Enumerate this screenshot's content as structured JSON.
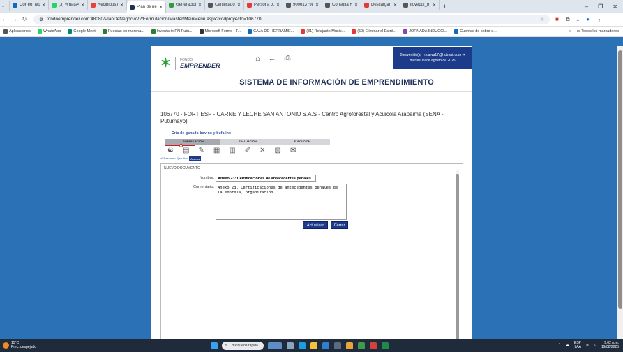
{
  "browser": {
    "tabs": [
      {
        "label": "Correo: Ivonn",
        "color": "#0f6cbd"
      },
      {
        "label": "(3) WhatsApp",
        "color": "#25d366"
      },
      {
        "label": "Recibidos (156",
        "color": "#ea4335"
      },
      {
        "label": "Plan de negoci",
        "color": "#1d2e57",
        "active": true
      },
      {
        "label": "Generación de",
        "color": "#2e9e3a"
      },
      {
        "label": "Certificado de",
        "color": "#555555"
      },
      {
        "label": "Persona Jurídic",
        "color": "#e53935"
      },
      {
        "label": "9006137984 (",
        "color": "#555555"
      },
      {
        "label": "Consulta RNM",
        "color": "#555555"
      },
      {
        "label": "Descargar arch",
        "color": "#e53935"
      },
      {
        "label": "ilovepdf_merg",
        "color": "#555555"
      }
    ],
    "url": "fondoemprender.com:48080/PlanDeNegocioV2/Formulacion/Master/MainMenu.aspx?codproyecto=106770",
    "bookmarks": [
      {
        "label": "Aplicaciones",
        "color": "#555555"
      },
      {
        "label": "WhatsApp",
        "color": "#25d366"
      },
      {
        "label": "Google Meet",
        "color": "#00897b"
      },
      {
        "label": "Puestas en marcha...",
        "color": "#2e7d32"
      },
      {
        "label": "Inventario PN Putu...",
        "color": "#2e7d32"
      },
      {
        "label": "Microsoft Forms - F...",
        "color": "#333333"
      },
      {
        "label": "CAJA DE HERRAMIE...",
        "color": "#0f6cbd"
      },
      {
        "label": "(31) Relajante Músic...",
        "color": "#e53935"
      },
      {
        "label": "(50) Eliminar el Estré...",
        "color": "#e53935"
      },
      {
        "label": "JORNADA INDUCCI...",
        "color": "#8e44ad"
      },
      {
        "label": "Cuentas de cobro e...",
        "color": "#0f6cbd"
      }
    ],
    "all_bookmarks": "Todos los marcadores"
  },
  "header": {
    "logo_small": "FONDO",
    "logo_big": "EMPRENDER",
    "welcome_line1": "Bienvenido(a) : ricarva17@hotmail.com",
    "welcome_line2": "martes 19 de agosto de 2025",
    "system_title": "SISTEMA DE INFORMACIÓN DE EMPRENDIMIENTO"
  },
  "project": {
    "title": "106770 - FORT ESP - CARNE Y LECHE SAN ANTONIO S.A.S - Centro Agroforestal y Acuicola Arapaima (SENA - Putumayo)",
    "subtitle": "Cría de ganado bovino y bufalino",
    "phases": [
      "FORMULACIÓN",
      "EVALUACIÓN",
      "EJECUCIÓN"
    ]
  },
  "subtabs": {
    "summary": "✔ Resumen Ejecutivo",
    "annexes": "Anexos"
  },
  "document": {
    "heading": "NUEVO DOCUMENTO",
    "name_label": "Nombre:",
    "name_value": "Anexo 23: Certificaciones de antecedentes penales",
    "comment_label": "Comentario:",
    "comment_value": "Anexo 23. Certificaciones de antecedentes penales de la empresa, organización",
    "update_button": "Actualizar",
    "close_button": "Cerrar"
  },
  "taskbar": {
    "temp": "15°C",
    "weather": "Prec. despejado",
    "search_placeholder": "Búsqueda rápida",
    "lang1": "ESP",
    "lang2": "LAA",
    "time": "9:02 p.m.",
    "date": "19/08/2025"
  }
}
